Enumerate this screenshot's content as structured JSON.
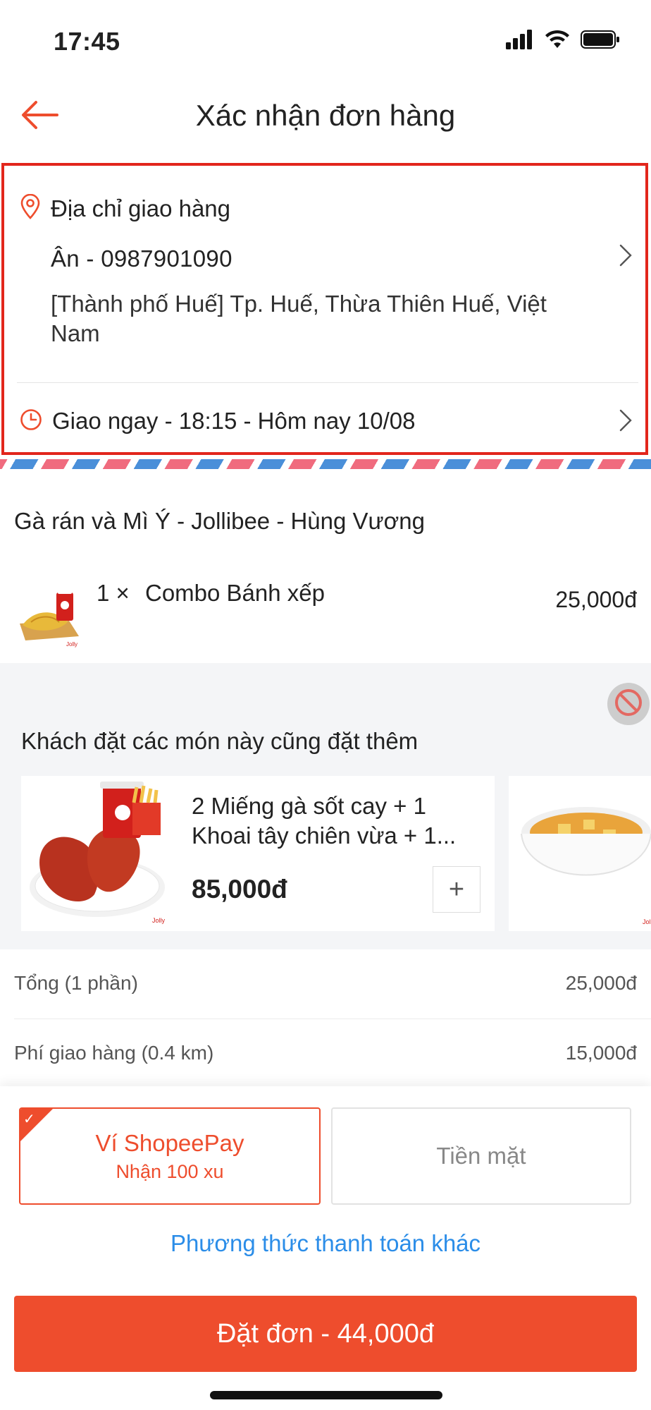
{
  "status_bar": {
    "time": "17:45"
  },
  "header": {
    "title": "Xác nhận đơn hàng"
  },
  "address": {
    "label": "Địa chỉ giao hàng",
    "contact": "Ân - 0987901090",
    "line": "[Thành phố Huế] Tp. Huế, Thừa Thiên Huế, Việt Nam",
    "delivery_time": "Giao ngay - 18:15 - Hôm nay 10/08"
  },
  "restaurant": {
    "name": "Gà rán và Mì Ý - Jollibee - Hùng Vương",
    "items": [
      {
        "qty": "1 ×",
        "name": "Combo Bánh xếp",
        "price": "25,000đ"
      }
    ]
  },
  "recommendations": {
    "title": "Khách đặt các món này cũng đặt thêm",
    "cards": [
      {
        "name": "2 Miếng gà sốt cay + 1 Khoai tây chiên vừa + 1...",
        "price": "85,000đ",
        "add_label": "+"
      }
    ]
  },
  "totals": {
    "subtotal_label": "Tổng (1 phần)",
    "subtotal_value": "25,000đ",
    "shipping_label": "Phí giao hàng (0.4 km)",
    "shipping_value": "15,000đ"
  },
  "payment": {
    "options": [
      {
        "label": "Ví ShopeePay",
        "sub": "Nhận 100 xu",
        "selected": true
      },
      {
        "label": "Tiền mặt",
        "selected": false
      }
    ],
    "other_label": "Phương thức thanh toán khác",
    "order_button": "Đặt đơn - 44,000đ"
  },
  "colors": {
    "accent": "#ee4d2d",
    "highlight_border": "#e2261c",
    "link": "#2b8de8"
  }
}
